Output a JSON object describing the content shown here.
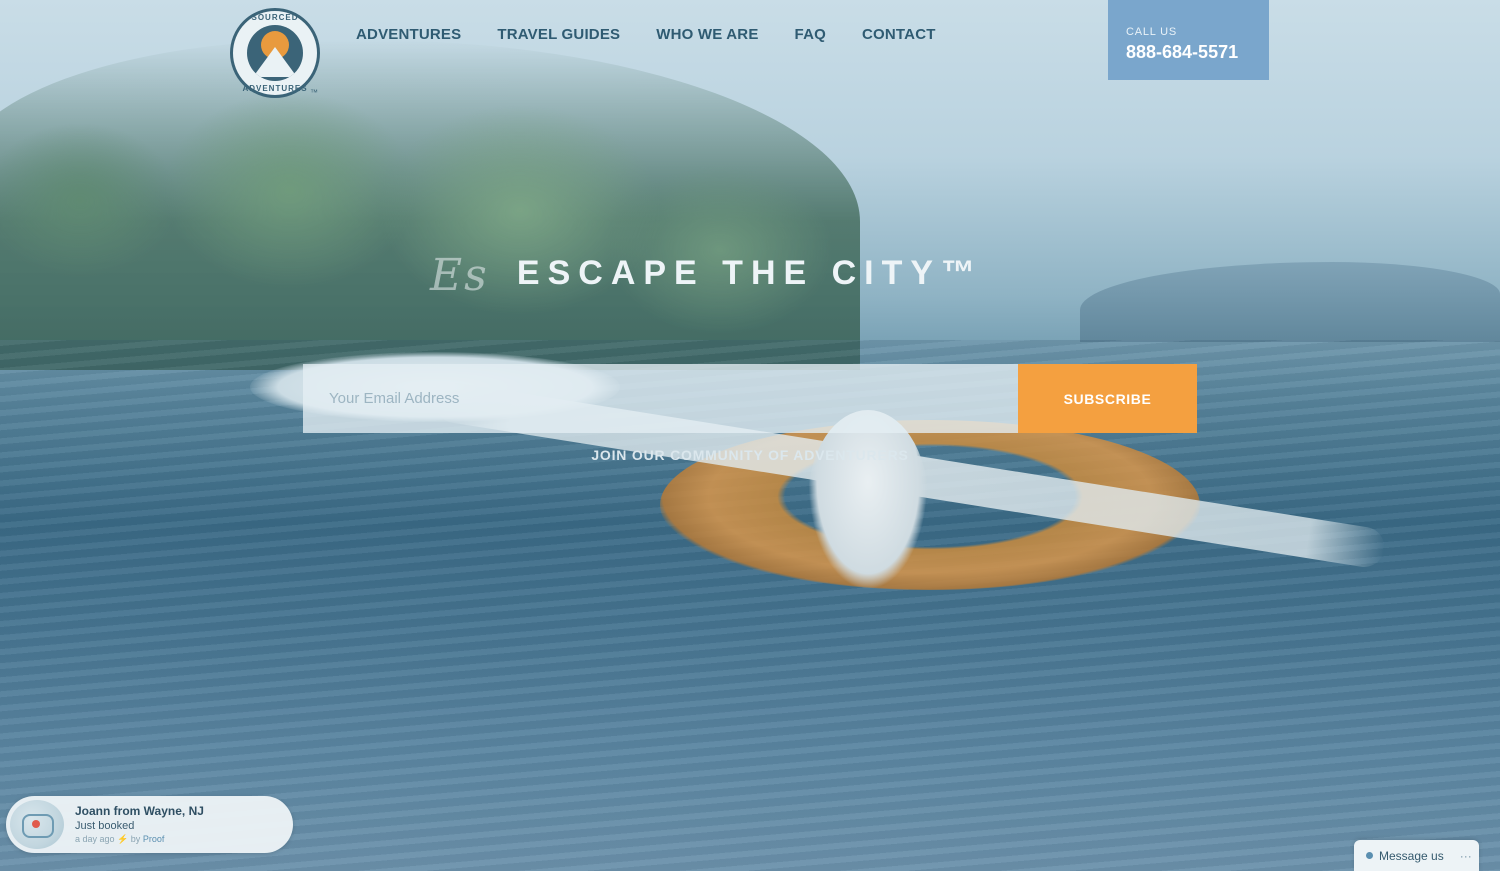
{
  "brand": {
    "logo_top": "SOURCED",
    "logo_bottom": "ADVENTURES",
    "trademark": "™"
  },
  "nav": {
    "items": [
      {
        "label": "ADVENTURES"
      },
      {
        "label": "TRAVEL GUIDES"
      },
      {
        "label": "WHO WE ARE"
      },
      {
        "label": "FAQ"
      },
      {
        "label": "CONTACT"
      }
    ]
  },
  "call": {
    "label": "CALL US",
    "number": "888-684-5571"
  },
  "hero": {
    "headline": "ESCAPE THE CITY™",
    "script_overlay": "Es"
  },
  "signup": {
    "email_placeholder": "Your Email Address",
    "subscribe_label": "SUBSCRIBE",
    "tagline": "JOIN OUR COMMUNITY OF ADVENTURERS"
  },
  "proof_popup": {
    "name": "Joann from Wayne, NJ",
    "action": "Just booked",
    "time": "a day ago",
    "by": "by",
    "proof": "Proof"
  },
  "chat": {
    "label": "Message us",
    "more": "···"
  },
  "colors": {
    "nav_text": "#2f5b72",
    "call_box": "#7aa6cc",
    "subscribe": "#f4a040"
  }
}
